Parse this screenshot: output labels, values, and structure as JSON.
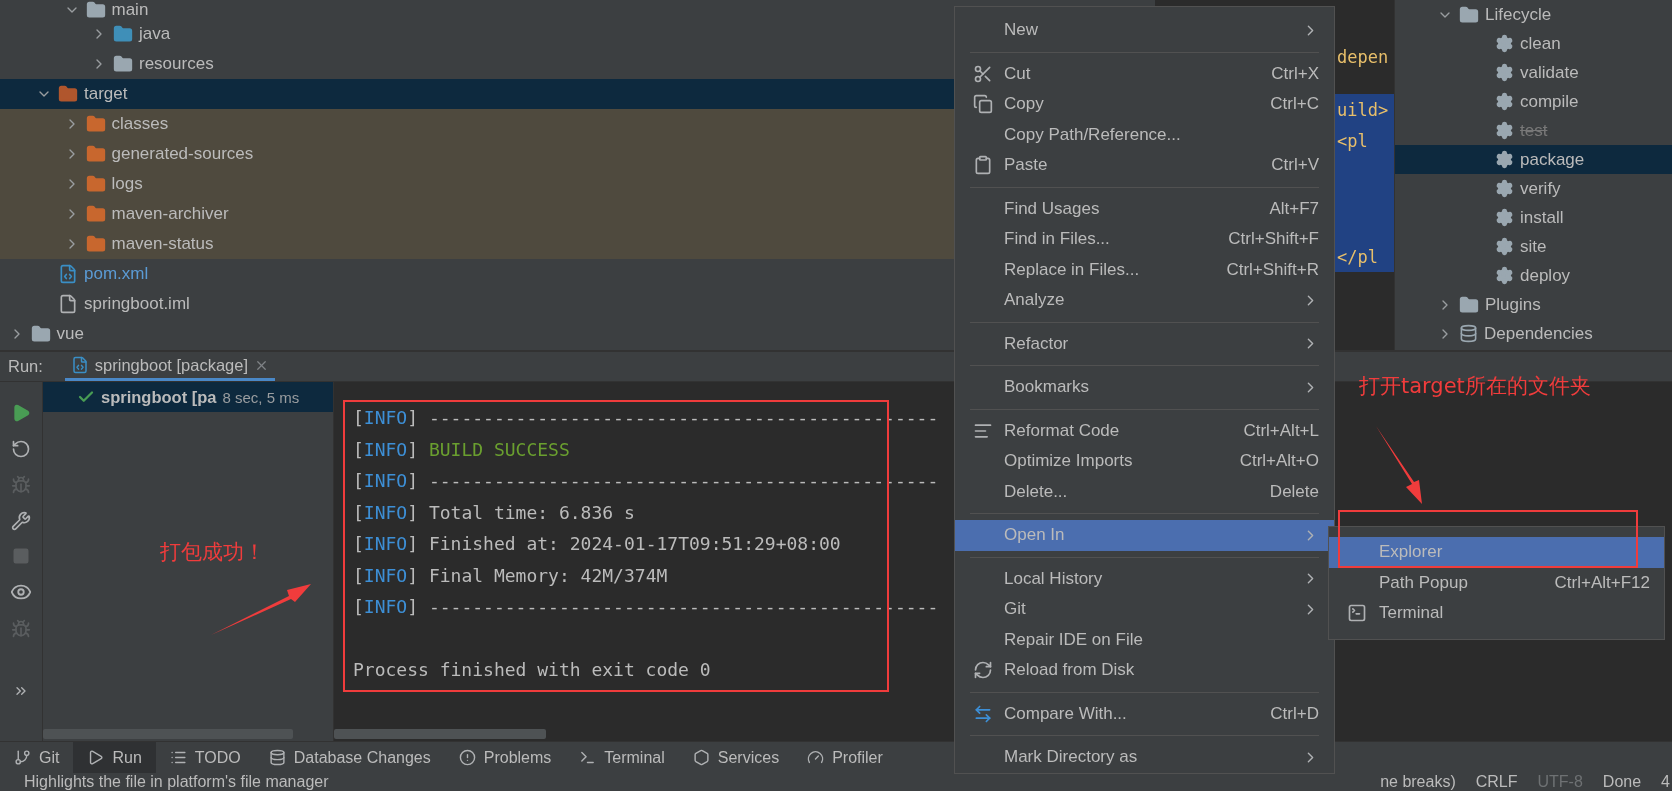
{
  "project_tree": {
    "items": [
      {
        "children": [
          {
            "children": [
              {
                "label": "main",
                "kind": "folder",
                "expanded": true,
                "selected": false,
                "children": [
                  {
                    "label": "java",
                    "kind": "source",
                    "expanded": false,
                    "selected": false
                  },
                  {
                    "label": "resources",
                    "kind": "resources",
                    "expanded": false,
                    "selected": false
                  }
                ]
              }
            ]
          },
          {
            "label": "target",
            "kind": "target",
            "expanded": true,
            "selected": true,
            "children": [
              {
                "label": "classes",
                "kind": "excluded",
                "expanded": false,
                "selected": false
              },
              {
                "label": "generated-sources",
                "kind": "excluded",
                "expanded": false,
                "selected": false
              },
              {
                "label": "logs",
                "kind": "excluded",
                "expanded": false,
                "selected": false
              },
              {
                "label": "maven-archiver",
                "kind": "excluded",
                "expanded": false,
                "selected": false
              },
              {
                "label": "maven-status",
                "kind": "excluded",
                "expanded": false,
                "selected": false
              }
            ]
          },
          {
            "label": "pom.xml",
            "kind": "maven-file",
            "selected": false
          },
          {
            "label": "springboot.iml",
            "kind": "module-file",
            "selected": false
          }
        ]
      },
      {
        "label": "vue",
        "kind": "folder",
        "expanded": false,
        "selected": false
      }
    ]
  },
  "editor": {
    "lines": [
      {
        "text": "depen"
      },
      {
        "text": "uild>"
      },
      {
        "text": "<pl"
      },
      {
        "text": "</pl"
      }
    ]
  },
  "maven": {
    "items": [
      {
        "label": "Lifecycle",
        "kind": "group",
        "expanded": true,
        "selected": false,
        "children": [
          {
            "label": "clean",
            "kind": "goal",
            "disabled": false,
            "selected": false
          },
          {
            "label": "validate",
            "kind": "goal",
            "disabled": false,
            "selected": false
          },
          {
            "label": "compile",
            "kind": "goal",
            "disabled": false,
            "selected": false
          },
          {
            "label": "test",
            "kind": "goal",
            "disabled": true,
            "selected": false
          },
          {
            "label": "package",
            "kind": "goal",
            "disabled": false,
            "selected": true
          },
          {
            "label": "verify",
            "kind": "goal",
            "disabled": false,
            "selected": false
          },
          {
            "label": "install",
            "kind": "goal",
            "disabled": false,
            "selected": false
          },
          {
            "label": "site",
            "kind": "goal",
            "disabled": false,
            "selected": false
          },
          {
            "label": "deploy",
            "kind": "goal",
            "disabled": false,
            "selected": false
          }
        ]
      },
      {
        "label": "Plugins",
        "kind": "group",
        "expanded": false,
        "selected": false
      },
      {
        "label": "Dependencies",
        "kind": "deps",
        "expanded": false,
        "selected": false
      }
    ]
  },
  "run": {
    "label": "Run:",
    "tab": {
      "title": "springboot [package]"
    },
    "tree": [
      {
        "label": "springboot [pa",
        "time": "8 sec, 5 ms",
        "selected": true
      }
    ],
    "console": [
      {
        "kind": "info",
        "open": "[",
        "tag": "INFO",
        "close": "]",
        "text": "-----------------------------------------------"
      },
      {
        "kind": "success",
        "open": "[",
        "tag": "INFO",
        "close": "]",
        "text": "BUILD SUCCESS"
      },
      {
        "kind": "info",
        "open": "[",
        "tag": "INFO",
        "close": "]",
        "text": "-----------------------------------------------"
      },
      {
        "kind": "info",
        "open": "[",
        "tag": "INFO",
        "close": "]",
        "text": "Total time: 6.836 s"
      },
      {
        "kind": "info",
        "open": "[",
        "tag": "INFO",
        "close": "]",
        "text": "Finished at: 2024-01-17T09:51:29+08:00"
      },
      {
        "kind": "info",
        "open": "[",
        "tag": "INFO",
        "close": "]",
        "text": "Final Memory: 42M/374M"
      },
      {
        "kind": "info",
        "open": "[",
        "tag": "INFO",
        "close": "]",
        "text": "-----------------------------------------------"
      },
      {
        "kind": "blank"
      },
      {
        "kind": "plain",
        "text": "Process finished with exit code 0"
      }
    ]
  },
  "context_menu": {
    "items": [
      {
        "kind": "item",
        "label": "New",
        "submenu": true,
        "selected": false
      },
      {
        "kind": "separator"
      },
      {
        "kind": "cut",
        "label": "Cut",
        "shortcut": "Ctrl+X",
        "submenu": false,
        "selected": false
      },
      {
        "kind": "copy",
        "label": "Copy",
        "shortcut": "Ctrl+C",
        "submenu": false,
        "selected": false
      },
      {
        "kind": "item",
        "label": "Copy Path/Reference...",
        "submenu": false,
        "selected": false
      },
      {
        "kind": "paste",
        "label": "Paste",
        "shortcut": "Ctrl+V",
        "submenu": false,
        "selected": false
      },
      {
        "kind": "separator"
      },
      {
        "kind": "item",
        "label": "Find Usages",
        "shortcut": "Alt+F7",
        "submenu": false,
        "selected": false
      },
      {
        "kind": "item",
        "label": "Find in Files...",
        "shortcut": "Ctrl+Shift+F",
        "submenu": false,
        "selected": false
      },
      {
        "kind": "item",
        "label": "Replace in Files...",
        "shortcut": "Ctrl+Shift+R",
        "submenu": false,
        "selected": false
      },
      {
        "kind": "item",
        "label": "Analyze",
        "submenu": true,
        "selected": false
      },
      {
        "kind": "separator"
      },
      {
        "kind": "item",
        "label": "Refactor",
        "submenu": true,
        "selected": false
      },
      {
        "kind": "separator"
      },
      {
        "kind": "item",
        "label": "Bookmarks",
        "submenu": true,
        "selected": false
      },
      {
        "kind": "separator"
      },
      {
        "kind": "reformat",
        "label": "Reformat Code",
        "shortcut": "Ctrl+Alt+L",
        "submenu": false,
        "selected": false
      },
      {
        "kind": "item",
        "label": "Optimize Imports",
        "shortcut": "Ctrl+Alt+O",
        "submenu": false,
        "selected": false
      },
      {
        "kind": "item",
        "label": "Delete...",
        "shortcut": "Delete",
        "submenu": false,
        "selected": false
      },
      {
        "kind": "separator"
      },
      {
        "kind": "item",
        "label": "Open In",
        "submenu": true,
        "selected": true
      },
      {
        "kind": "separator"
      },
      {
        "kind": "item",
        "label": "Local History",
        "submenu": true,
        "selected": false
      },
      {
        "kind": "item",
        "label": "Git",
        "submenu": true,
        "selected": false
      },
      {
        "kind": "item",
        "label": "Repair IDE on File",
        "submenu": false,
        "selected": false
      },
      {
        "kind": "reload",
        "label": "Reload from Disk",
        "submenu": false,
        "selected": false
      },
      {
        "kind": "separator"
      },
      {
        "kind": "compare",
        "label": "Compare With...",
        "shortcut": "Ctrl+D",
        "submenu": false,
        "selected": false
      },
      {
        "kind": "separator"
      },
      {
        "kind": "item",
        "label": "Mark Directory as",
        "submenu": true,
        "selected": false
      }
    ]
  },
  "submenu": {
    "items": [
      {
        "kind": "item",
        "label": "Explorer",
        "selected": true
      },
      {
        "kind": "item",
        "label": "Path Popup",
        "shortcut": "Ctrl+Alt+F12",
        "selected": false
      },
      {
        "kind": "terminal",
        "label": "Terminal",
        "selected": false
      }
    ]
  },
  "annotations": [
    {
      "text": "打包成功！"
    },
    {
      "text": "打开target所在的文件夹"
    }
  ],
  "tool_tabs": [
    {
      "kind": "git",
      "label": "Git",
      "selected": false
    },
    {
      "kind": "run",
      "label": "Run",
      "selected": true
    },
    {
      "kind": "todo",
      "label": "TODO",
      "selected": false
    },
    {
      "kind": "database",
      "label": "Database Changes",
      "selected": false
    },
    {
      "kind": "problems",
      "label": "Problems",
      "selected": false
    },
    {
      "kind": "terminal",
      "label": "Terminal",
      "selected": false
    },
    {
      "kind": "services",
      "label": "Services",
      "selected": false
    },
    {
      "kind": "profiler",
      "label": "Profiler",
      "selected": false
    }
  ],
  "status_bar": {
    "message": "Highlights the file in platform's file manager",
    "items": [
      {
        "kind": "text",
        "text": "ne breaks)"
      },
      {
        "kind": "text",
        "text": "CRLF"
      },
      {
        "kind": "dim",
        "text": "UTF-8"
      },
      {
        "kind": "text",
        "text": "Done"
      },
      {
        "kind": "text",
        "text": "4"
      }
    ]
  }
}
